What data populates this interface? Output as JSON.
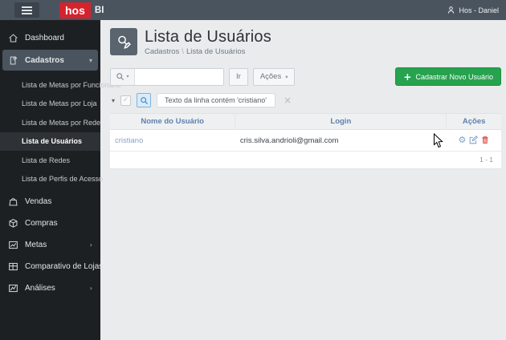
{
  "topbar": {
    "logo_primary": "hos",
    "logo_secondary": "BI",
    "user": "Hos - Daniel"
  },
  "sidebar": {
    "items": [
      {
        "label": "Dashboard"
      },
      {
        "label": "Cadastros"
      },
      {
        "label": "Vendas"
      },
      {
        "label": "Compras"
      },
      {
        "label": "Metas"
      },
      {
        "label": "Comparativo de Lojas"
      },
      {
        "label": "Análises"
      }
    ],
    "cadastros_children": [
      "Lista de Metas por Funcionário",
      "Lista de Metas por Loja",
      "Lista de Metas por Rede",
      "Lista de Usuários",
      "Lista de Redes",
      "Lista de Perfis de Acesso"
    ]
  },
  "page": {
    "title": "Lista de Usuários",
    "breadcrumb_parent": "Cadastros",
    "breadcrumb_sep": "\\",
    "breadcrumb_current": "Lista de Usuários"
  },
  "toolbar": {
    "search_value": "",
    "go_label": "Ir",
    "actions_label": "Ações",
    "new_user_label": "Cadastrar Novo Usuário"
  },
  "filter": {
    "text": "Texto da linha contém 'cristiano'"
  },
  "table": {
    "columns": [
      "Nome do Usuário",
      "Login",
      "Ações"
    ],
    "rows": [
      {
        "nome": "cristiano",
        "login": "cris.silva.andrioli@gmail.com"
      }
    ],
    "pagination": "1 - 1"
  },
  "icons": {
    "plus": "+",
    "chevron_down": "▾",
    "chevron_right": "›",
    "triangle_down": "▾",
    "check": "✓",
    "close": "×",
    "gear": "⚙"
  },
  "colors": {
    "topbar": "#4a545e",
    "logo_red": "#d5232e",
    "accent_green": "#27a24e",
    "header_blue": "#5e80ae",
    "danger_red": "#d9534f"
  }
}
